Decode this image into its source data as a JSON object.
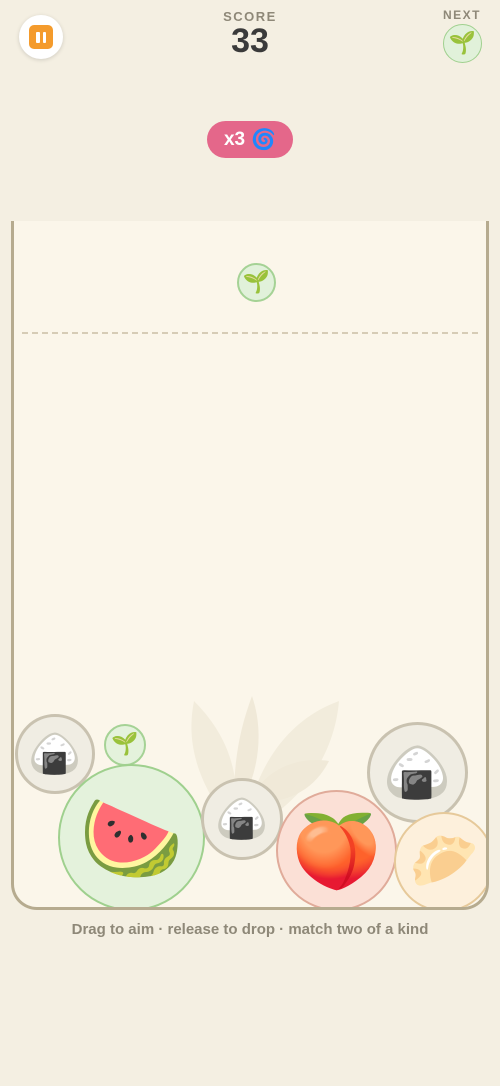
{
  "score": {
    "label": "SCORE",
    "value": "33"
  },
  "next": {
    "label": "NEXT",
    "icon": "🌱",
    "icon_name": "sprout-icon"
  },
  "combo": {
    "text": "x3",
    "icon": "🌀",
    "icon_name": "cyclone-icon"
  },
  "aim_piece": {
    "icon": "🌱",
    "icon_name": "sprout-icon"
  },
  "board": {
    "pieces": [
      {
        "name": "rice-ball-orb",
        "icon": "🍙"
      },
      {
        "name": "sprout-orb",
        "icon": "🌱"
      },
      {
        "name": "watermelon-orb",
        "icon": "🍉"
      },
      {
        "name": "rice-ball-orb",
        "icon": "🍙"
      },
      {
        "name": "peach-orb",
        "icon": "🍑"
      },
      {
        "name": "rice-ball-orb",
        "icon": "🍙"
      },
      {
        "name": "dumpling-orb",
        "icon": "🥟"
      }
    ]
  },
  "hint": "Drag to aim · release to drop · match two of a kind",
  "colors": {
    "background": "#f4efe2",
    "jar": "#fbf6ea",
    "combo_badge": "#e4678a",
    "pause_button": "#f49b2c"
  }
}
